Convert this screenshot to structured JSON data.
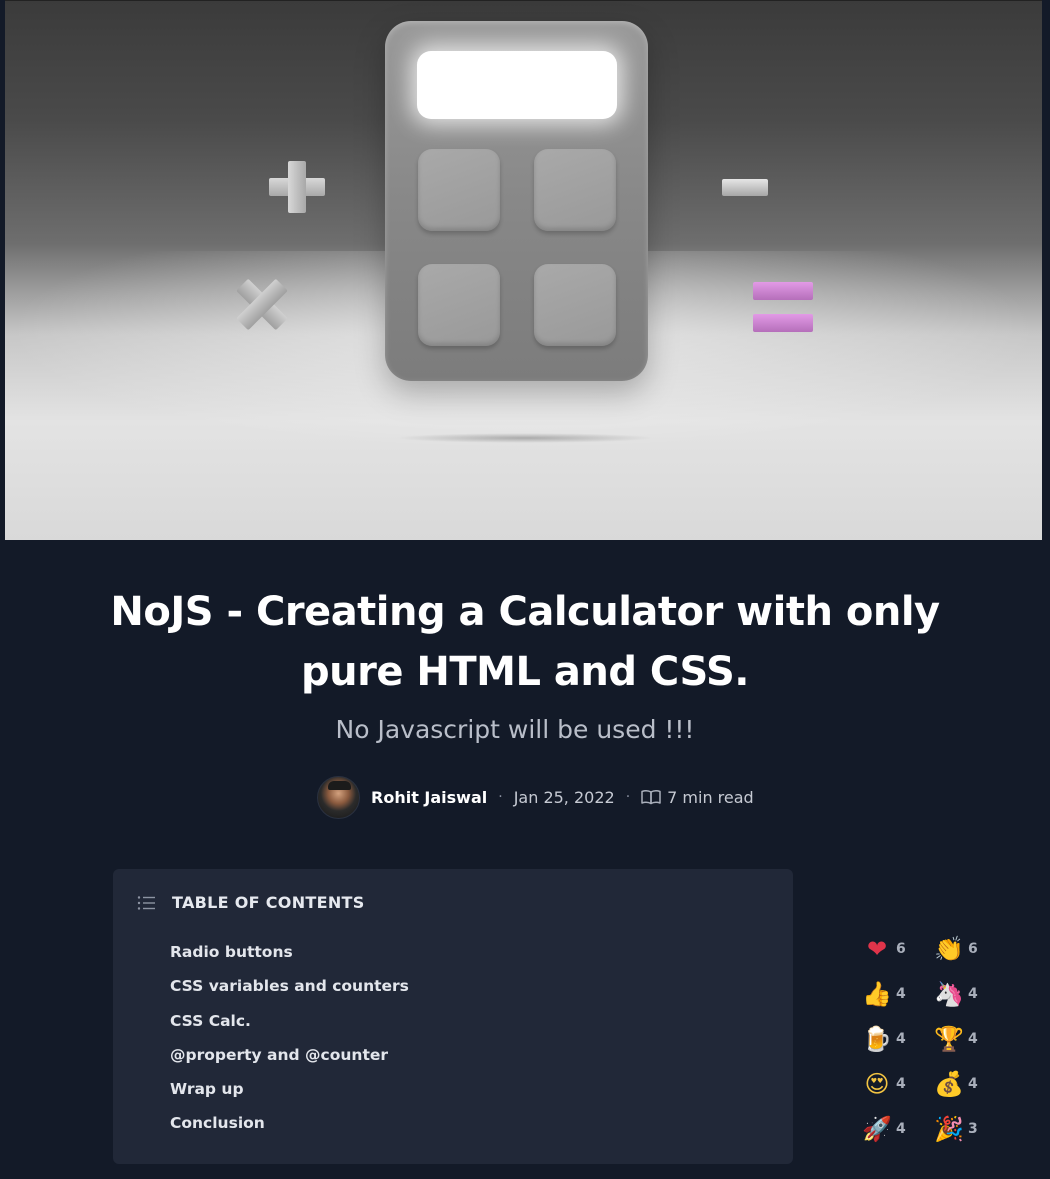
{
  "article": {
    "title": "NoJS - Creating a Calculator with only pure HTML and CSS.",
    "subtitle": "No Javascript will be used !!!",
    "author": "Rohit Jaiswal",
    "date": "Jan 25, 2022",
    "read_time": "7 min read",
    "separator": "·"
  },
  "hero": {
    "image_subject": "calculator-illustration",
    "accent_color": "#d98ee0"
  },
  "toc": {
    "title": "TABLE OF CONTENTS",
    "items": [
      "Radio buttons",
      "CSS variables and counters",
      "CSS Calc.",
      "@property and @counter",
      "Wrap up",
      "Conclusion"
    ]
  },
  "reactions": [
    {
      "icon": "heart-icon",
      "glyph": "❤",
      "count": "6"
    },
    {
      "icon": "clap-icon",
      "glyph": "👏",
      "count": "6"
    },
    {
      "icon": "thumbs-up-icon",
      "glyph": "👍",
      "count": "4"
    },
    {
      "icon": "unicorn-icon",
      "glyph": "🦄",
      "count": "4"
    },
    {
      "icon": "beer-icon",
      "glyph": "🍺",
      "count": "4"
    },
    {
      "icon": "trophy-icon",
      "glyph": "🏆",
      "count": "4"
    },
    {
      "icon": "heart-eyes-icon",
      "glyph": "😍",
      "count": "4"
    },
    {
      "icon": "money-bag-icon",
      "glyph": "💰",
      "count": "4"
    },
    {
      "icon": "rocket-icon",
      "glyph": "🚀",
      "count": "4"
    },
    {
      "icon": "party-popper-icon",
      "glyph": "🎉",
      "count": "3"
    }
  ],
  "colors": {
    "page_bg": "#131a28",
    "card_bg": "#212838",
    "text": "#ffffff",
    "muted": "#b9bec9"
  }
}
